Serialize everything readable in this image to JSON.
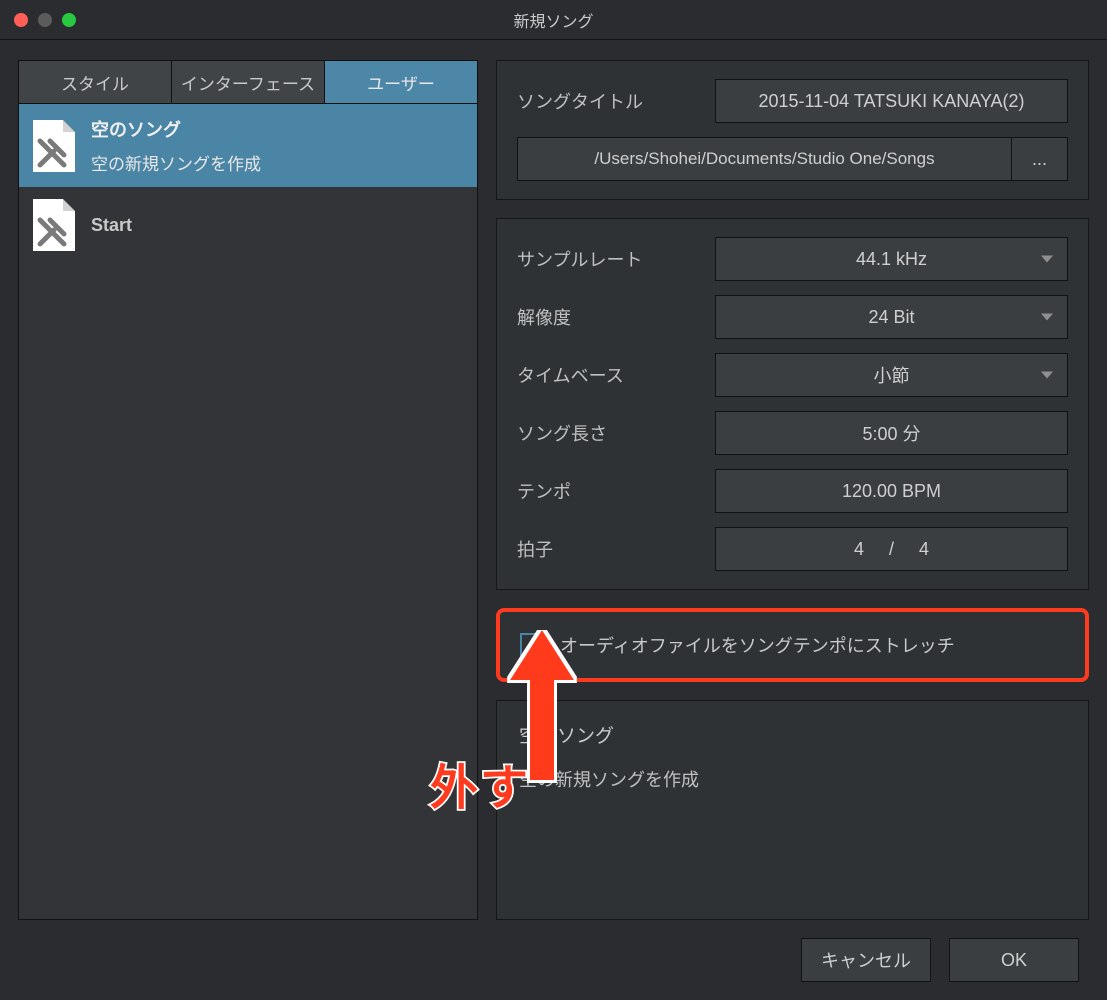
{
  "window": {
    "title": "新規ソング"
  },
  "tabs": {
    "style": "スタイル",
    "interface": "インターフェース",
    "user": "ユーザー"
  },
  "templates": [
    {
      "title": "空のソング",
      "desc": "空の新規ソングを作成"
    },
    {
      "title": "Start"
    }
  ],
  "form": {
    "songTitle": {
      "label": "ソングタイトル",
      "value": "2015-11-04 TATSUKI KANAYA(2)"
    },
    "path": {
      "value": "/Users/Shohei/Documents/Studio One/Songs",
      "browse": "..."
    },
    "sampleRate": {
      "label": "サンプルレート",
      "value": "44.1 kHz"
    },
    "resolution": {
      "label": "解像度",
      "value": "24 Bit"
    },
    "timebase": {
      "label": "タイムベース",
      "value": "小節"
    },
    "songLength": {
      "label": "ソング長さ",
      "value": "5:00 分"
    },
    "tempo": {
      "label": "テンポ",
      "value": "120.00 BPM"
    },
    "timeSig": {
      "label": "拍子",
      "num": "4",
      "sep": "/",
      "den": "4"
    },
    "stretch": {
      "label": "オーディオファイルをソングテンポにストレッチ",
      "checked": false
    }
  },
  "description": {
    "title": "空のソング",
    "body": "空の新規ソングを作成"
  },
  "footer": {
    "cancel": "キャンセル",
    "ok": "OK"
  },
  "annotation": {
    "text": "外す"
  },
  "colors": {
    "accent": "#4a85a6",
    "highlight": "#ff3b1f"
  }
}
